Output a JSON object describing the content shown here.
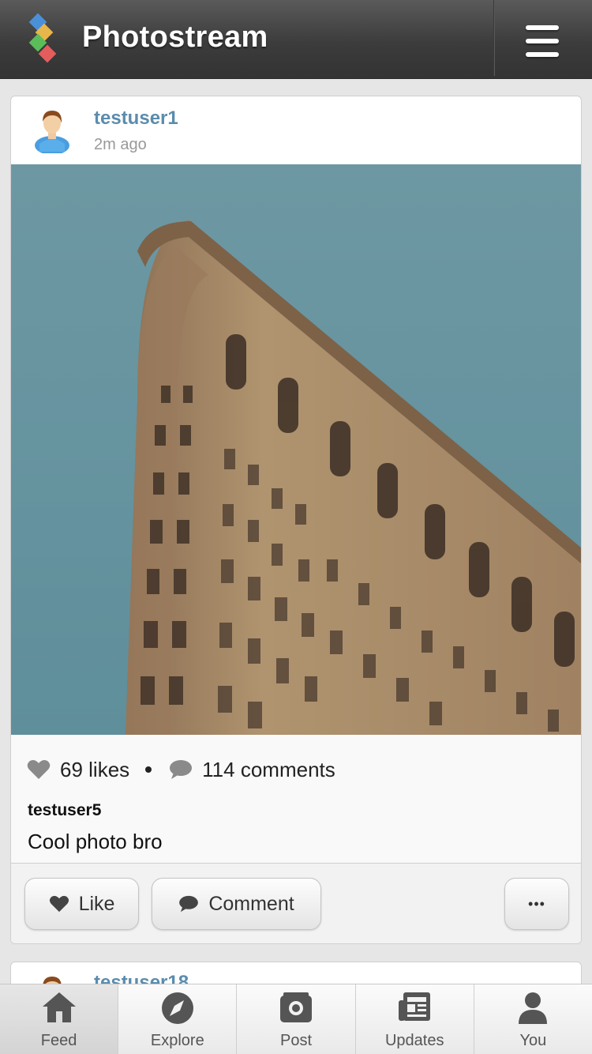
{
  "header": {
    "title": "Photostream",
    "logo_icon": "diamond-logo-icon",
    "menu_icon": "hamburger-menu-icon"
  },
  "post": {
    "username": "testuser1",
    "timestamp": "2m ago",
    "photo_alt": "Flatiron building against blue sky",
    "likes": "69 likes",
    "comments": "114 comments",
    "latest_comment": {
      "user": "testuser5",
      "text": "Cool photo bro"
    },
    "actions": {
      "like_label": "Like",
      "comment_label": "Comment",
      "more_label": "•••"
    }
  },
  "next_post": {
    "username": "testuser18"
  },
  "tabs": [
    {
      "label": "Feed",
      "icon": "home-icon",
      "active": true
    },
    {
      "label": "Explore",
      "icon": "compass-icon",
      "active": false
    },
    {
      "label": "Post",
      "icon": "camera-icon",
      "active": false
    },
    {
      "label": "Updates",
      "icon": "newspaper-icon",
      "active": false
    },
    {
      "label": "You",
      "icon": "user-icon",
      "active": false
    }
  ],
  "colors": {
    "accent": "#5b8cad",
    "header_bg": "#3c3c3c",
    "sky": "#6f9ba6",
    "building": "#a88a6a"
  }
}
